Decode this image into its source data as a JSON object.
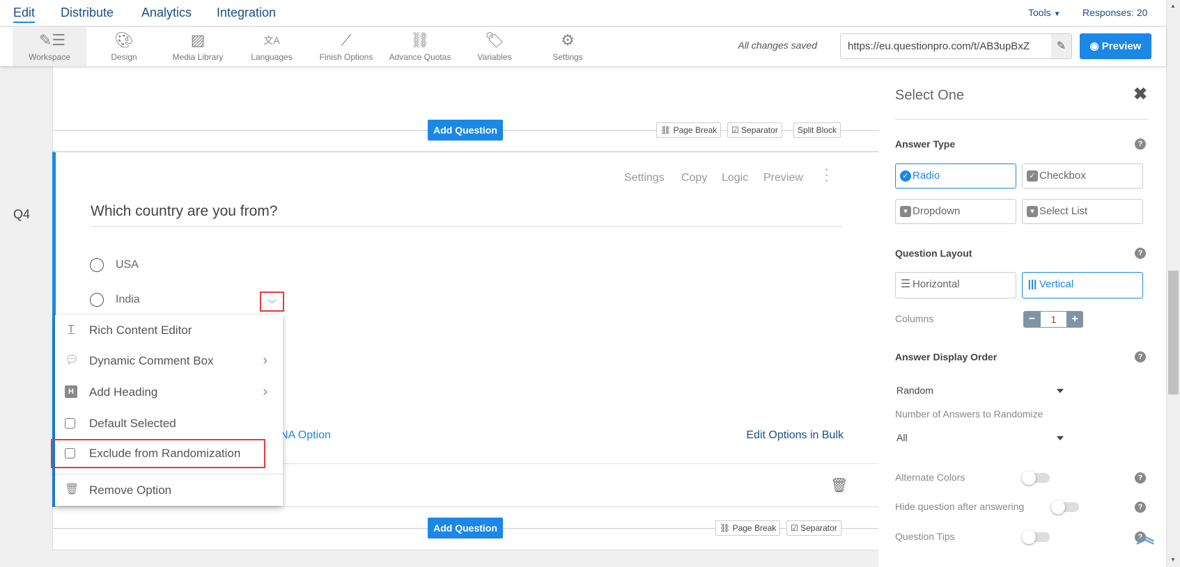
{
  "topnav": {
    "tabs": [
      "Edit",
      "Distribute",
      "Analytics",
      "Integration"
    ],
    "active": "Edit",
    "tools": "Tools",
    "responses": "Responses: 20"
  },
  "toolbar": {
    "items": [
      {
        "label": "Workspace",
        "icon": "workspace-icon"
      },
      {
        "label": "Design",
        "icon": "palette-icon"
      },
      {
        "label": "Media Library",
        "icon": "image-icon"
      },
      {
        "label": "Languages",
        "icon": "translate-icon"
      },
      {
        "label": "Finish Options",
        "icon": "magic-wand-icon"
      },
      {
        "label": "Advance Quotas",
        "icon": "link-icon"
      },
      {
        "label": "Variables",
        "icon": "tag-icon"
      },
      {
        "label": "Settings",
        "icon": "gear-icon"
      }
    ],
    "saved": "All changes saved",
    "url": "https://eu.questionpro.com/t/AB3upBxZ",
    "preview": "Preview"
  },
  "block_top": {
    "add_question": "Add Question",
    "page_break": "Page Break",
    "separator": "Separator",
    "split_block": "Split Block"
  },
  "question": {
    "number": "Q4",
    "text": "Which country are you from?",
    "actions": [
      "Settings",
      "Copy",
      "Logic",
      "Preview"
    ],
    "options": [
      "USA",
      "India"
    ],
    "na_option": "NA Option",
    "edit_bulk": "Edit Options in Bulk"
  },
  "option_menu": {
    "items": [
      "Rich Content Editor",
      "Dynamic Comment Box",
      "Add Heading",
      "Default Selected",
      "Exclude from Randomization",
      "Remove Option"
    ]
  },
  "block_bottom": {
    "add_question": "Add Question",
    "page_break": "Page Break",
    "separator": "Separator"
  },
  "panel": {
    "title": "Select One",
    "answer_type": "Answer Type",
    "types": [
      "Radio",
      "Checkbox",
      "Dropdown",
      "Select List"
    ],
    "selected_type": "Radio",
    "question_layout": "Question Layout",
    "layouts": [
      "Horizontal",
      "Vertical"
    ],
    "selected_layout": "Vertical",
    "columns_label": "Columns",
    "columns": "1",
    "display_order": "Answer Display Order",
    "order_value": "Random",
    "num_randomize_label": "Number of Answers to Randomize",
    "num_randomize": "All",
    "alternate_colors": "Alternate Colors",
    "alternate_colors_on": false,
    "hide_after": "Hide question after answering",
    "hide_after_on": false,
    "tips": "Question Tips",
    "tips_on": false
  },
  "colors": {
    "accent": "#1b87e6",
    "highlight": "#e8393a"
  }
}
